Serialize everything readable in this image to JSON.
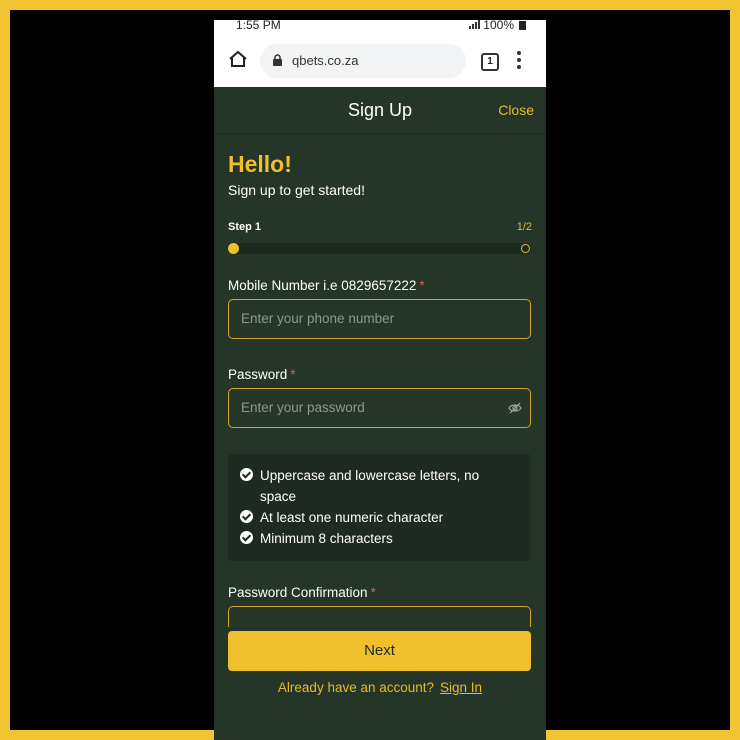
{
  "status": {
    "time": "1:55 PM",
    "battery": "100%"
  },
  "browser": {
    "url": "qbets.co.za",
    "tab_count": "1"
  },
  "header": {
    "title": "Sign Up",
    "close_label": "Close"
  },
  "intro": {
    "greeting": "Hello!",
    "subtitle": "Sign up to get started!"
  },
  "progress": {
    "step_label": "Step 1",
    "step_count": "1/2",
    "current_step": 1,
    "total_steps": 2
  },
  "form": {
    "mobile": {
      "label": "Mobile Number i.e 0829657222",
      "required_mark": "*",
      "placeholder": "Enter your phone number",
      "value": ""
    },
    "password": {
      "label": "Password",
      "required_mark": "*",
      "placeholder": "Enter your password",
      "value": ""
    },
    "password_confirm": {
      "label": "Password Confirmation",
      "required_mark": "*"
    }
  },
  "rules": [
    "Uppercase and lowercase letters, no space",
    "At least one numeric character",
    "Minimum 8 characters"
  ],
  "actions": {
    "next_label": "Next",
    "account_prompt": "Already have an account?",
    "sign_in_label": "Sign In"
  },
  "colors": {
    "accent": "#f0bf2c",
    "background": "#253629",
    "page_border": "#f2c333"
  }
}
